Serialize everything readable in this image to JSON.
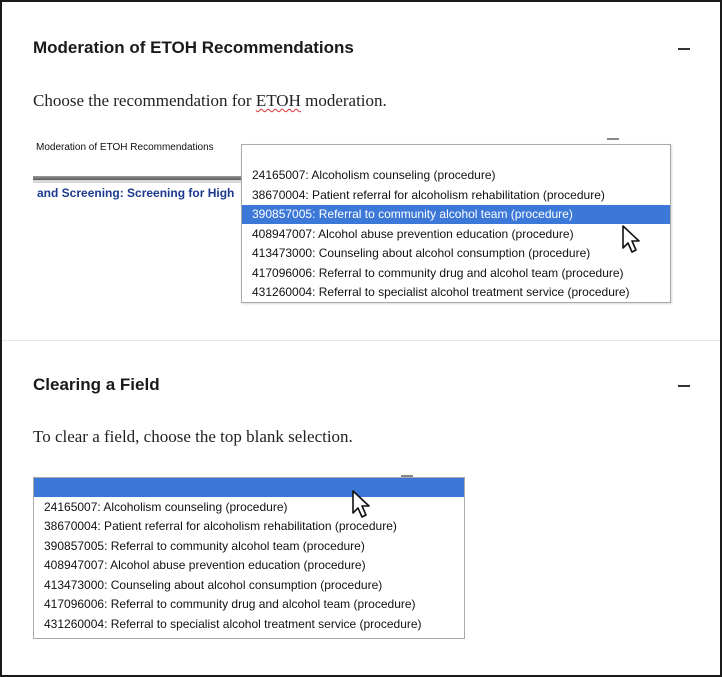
{
  "sections": [
    {
      "heading": "Moderation of ETOH Recommendations",
      "collapse_symbol": "minus-icon",
      "description": {
        "before": "Choose the recommendation for ",
        "underlined": "ETOH",
        "after": " moderation."
      },
      "screenshot": {
        "form_label": "Moderation of ETOH Recommendations",
        "banner_text": "and Screening: Screening for High",
        "selected_index": 2,
        "options": [
          "24165007: Alcoholism counseling (procedure)",
          "38670004: Patient referral for alcoholism rehabilitation (procedure)",
          "390857005: Referral to community alcohol team (procedure)",
          "408947007: Alcohol abuse prevention education (procedure)",
          "413473000: Counseling about alcohol consumption (procedure)",
          "417096006: Referral to community drug and alcohol team (procedure)",
          "431260004: Referral to specialist alcohol treatment service (procedure)"
        ]
      }
    },
    {
      "heading": "Clearing a Field",
      "collapse_symbol": "minus-icon",
      "description": "To clear a field, choose the top blank selection.",
      "screenshot": {
        "selected_index": 0,
        "options": [
          "",
          "24165007: Alcoholism counseling (procedure)",
          "38670004: Patient referral for alcoholism rehabilitation (procedure)",
          "390857005: Referral to community alcohol team (procedure)",
          "408947007: Alcohol abuse prevention education (procedure)",
          "413473000: Counseling about alcohol consumption (procedure)",
          "417096006: Referral to community drug and alcohol team (procedure)",
          "431260004: Referral to specialist alcohol treatment service (procedure)"
        ]
      }
    }
  ],
  "colors": {
    "selection": "#3c78d8",
    "banner_text": "#1c3a8c",
    "spell_underline": "#d33"
  }
}
